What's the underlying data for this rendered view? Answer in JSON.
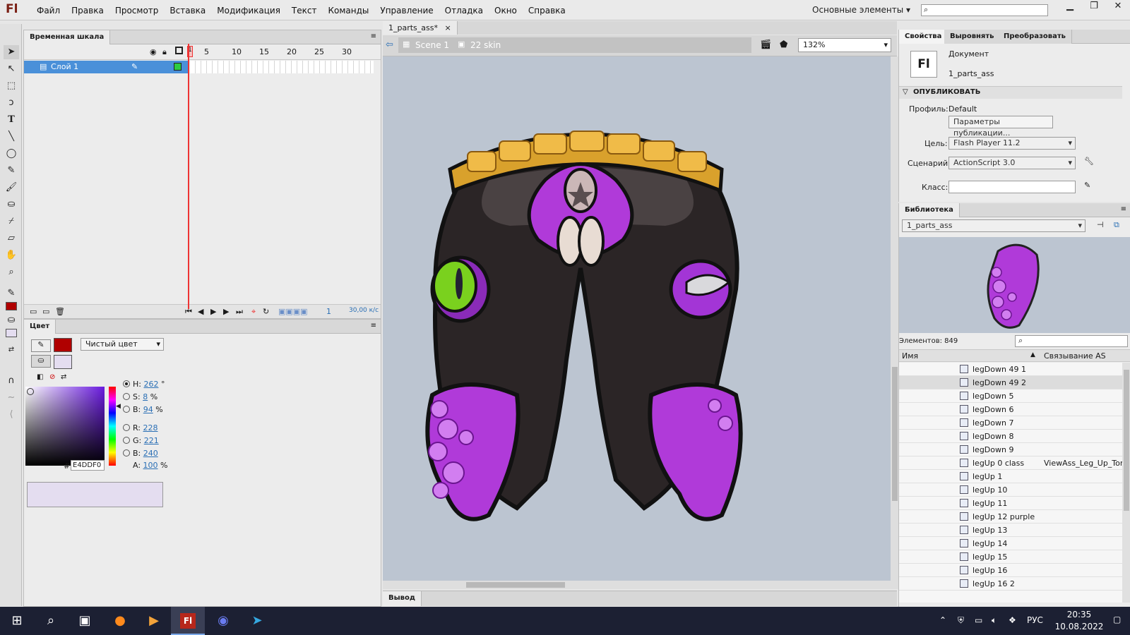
{
  "app": {
    "logo": "Fl",
    "workspace": "Основные элементы"
  },
  "menu": [
    "Файл",
    "Правка",
    "Просмотр",
    "Вставка",
    "Модификация",
    "Текст",
    "Команды",
    "Управление",
    "Отладка",
    "Окно",
    "Справка"
  ],
  "timeline": {
    "tab": "Временная шкала",
    "ruler": [
      "1",
      "5",
      "10",
      "15",
      "20",
      "25",
      "30"
    ],
    "layer_name": "Слой 1",
    "current_frame": "1",
    "fps": "30,00 к/с"
  },
  "color": {
    "tab": "Цвет",
    "stroke_color": "#b00000",
    "fill_color": "#e4ddf0",
    "fill_type": "Чистый цвет",
    "H": "262",
    "H_unit": "°",
    "S": "8",
    "S_unit": "%",
    "B": "94",
    "B_unit": "%",
    "R": "228",
    "G": "221",
    "Bv": "240",
    "A": "100",
    "A_unit": "%",
    "hex_label": "#",
    "hex": "E4DDF0"
  },
  "document": {
    "tab": "1_parts_ass*",
    "scene": "Scene 1",
    "symbol": "22 skin",
    "zoom": "132%",
    "output_tab": "Вывод"
  },
  "properties": {
    "tabs": [
      "Свойства",
      "Выровнять",
      "Преобразовать"
    ],
    "doc_label": "Документ",
    "doc_name": "1_parts_ass",
    "publish_header": "ОПУБЛИКОВАТЬ",
    "profile_label": "Профиль:",
    "profile_value": "Default",
    "publish_settings": "Параметры публикации...",
    "target_label": "Цель:",
    "target_value": "Flash Player 11.2",
    "script_label": "Сценарий:",
    "script_value": "ActionScript 3.0",
    "class_label": "Класс:"
  },
  "library": {
    "tab": "Библиотека",
    "doc": "1_parts_ass",
    "count": "Элементов: 849",
    "col_name": "Имя",
    "col_link": "Связывание AS",
    "items": [
      {
        "name": "legDown 49 1",
        "link": ""
      },
      {
        "name": "legDown 49 2",
        "link": ""
      },
      {
        "name": "legDown 5",
        "link": ""
      },
      {
        "name": "legDown 6",
        "link": ""
      },
      {
        "name": "legDown 7",
        "link": ""
      },
      {
        "name": "legDown 8",
        "link": ""
      },
      {
        "name": "legDown 9",
        "link": ""
      },
      {
        "name": "legUp 0 class",
        "link": "ViewAss_Leg_Up_Ton"
      },
      {
        "name": "legUp 1",
        "link": ""
      },
      {
        "name": "legUp 10",
        "link": ""
      },
      {
        "name": "legUp 11",
        "link": ""
      },
      {
        "name": "legUp 12 purple",
        "link": ""
      },
      {
        "name": "legUp 13",
        "link": ""
      },
      {
        "name": "legUp 14",
        "link": ""
      },
      {
        "name": "legUp 15",
        "link": ""
      },
      {
        "name": "legUp 16",
        "link": ""
      },
      {
        "name": "legUp 16 2",
        "link": ""
      }
    ]
  },
  "taskbar": {
    "lang": "РУС",
    "time": "20:35",
    "date": "10.08.2022"
  }
}
